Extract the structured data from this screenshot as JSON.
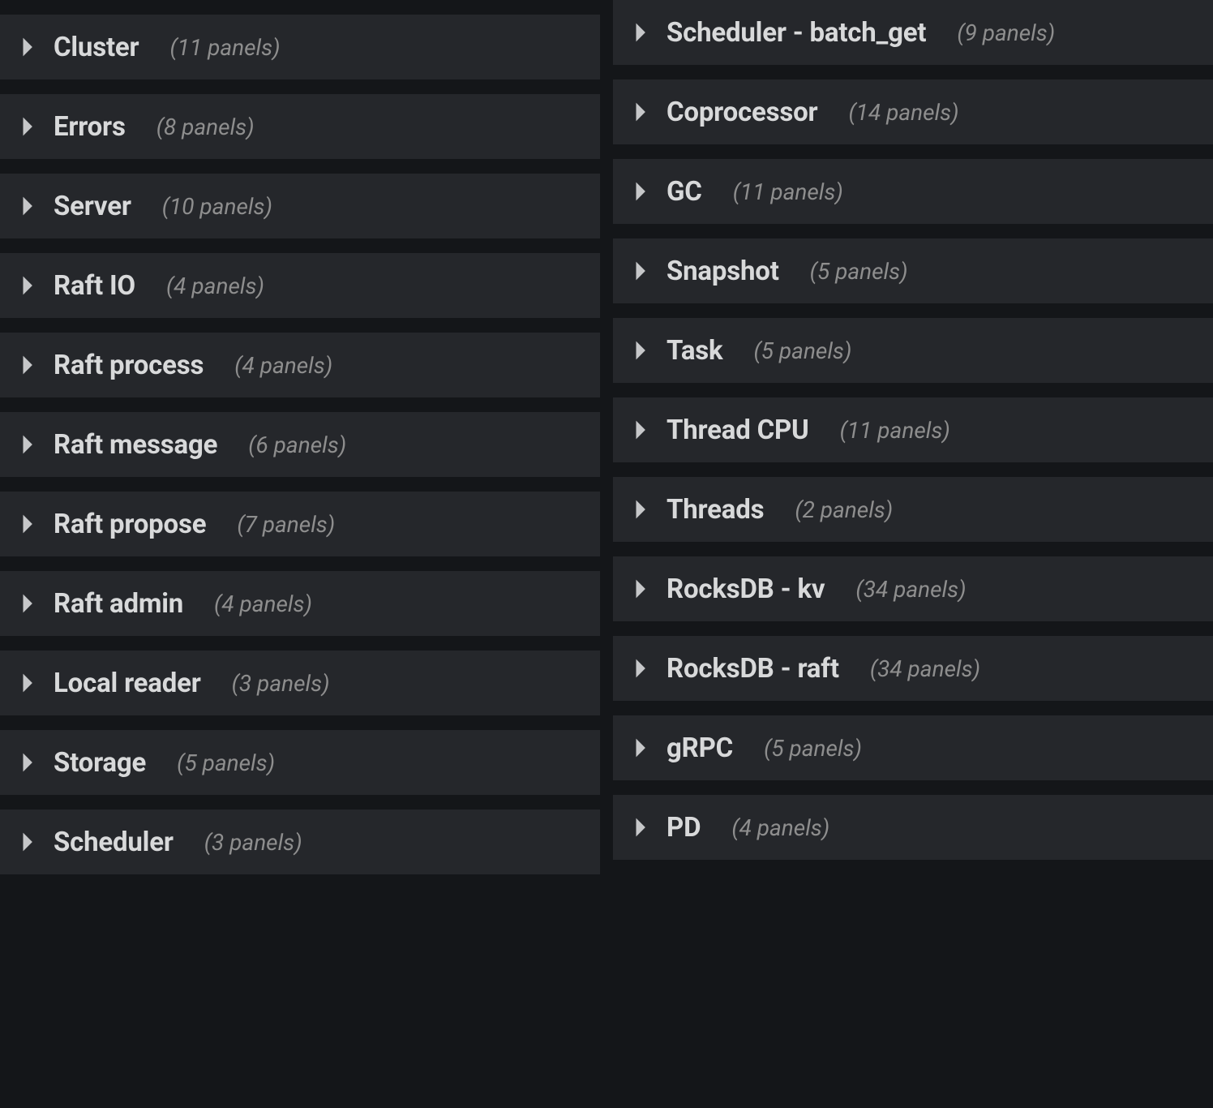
{
  "left": [
    {
      "title": "Cluster",
      "meta": "(11 panels)"
    },
    {
      "title": "Errors",
      "meta": "(8 panels)"
    },
    {
      "title": "Server",
      "meta": "(10 panels)"
    },
    {
      "title": "Raft IO",
      "meta": "(4 panels)"
    },
    {
      "title": "Raft process",
      "meta": "(4 panels)"
    },
    {
      "title": "Raft message",
      "meta": "(6 panels)"
    },
    {
      "title": "Raft propose",
      "meta": "(7 panels)"
    },
    {
      "title": "Raft admin",
      "meta": "(4 panels)"
    },
    {
      "title": "Local reader",
      "meta": "(3 panels)"
    },
    {
      "title": "Storage",
      "meta": "(5 panels)"
    },
    {
      "title": "Scheduler",
      "meta": "(3 panels)"
    }
  ],
  "right": [
    {
      "title": "Scheduler - batch_get",
      "meta": "(9 panels)"
    },
    {
      "title": "Coprocessor",
      "meta": "(14 panels)"
    },
    {
      "title": "GC",
      "meta": "(11 panels)"
    },
    {
      "title": "Snapshot",
      "meta": "(5 panels)"
    },
    {
      "title": "Task",
      "meta": "(5 panels)"
    },
    {
      "title": "Thread CPU",
      "meta": "(11 panels)"
    },
    {
      "title": "Threads",
      "meta": "(2 panels)"
    },
    {
      "title": "RocksDB - kv",
      "meta": "(34 panels)"
    },
    {
      "title": "RocksDB - raft",
      "meta": "(34 panels)"
    },
    {
      "title": "gRPC",
      "meta": "(5 panels)"
    },
    {
      "title": "PD",
      "meta": "(4 panels)"
    }
  ]
}
